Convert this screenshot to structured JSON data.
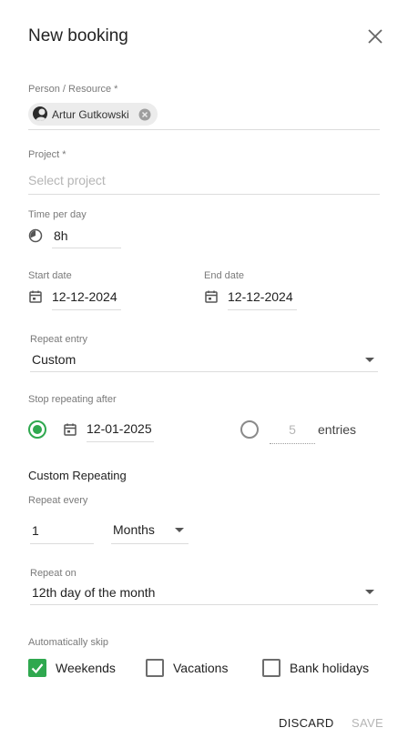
{
  "dialog": {
    "title": "New booking"
  },
  "person": {
    "label": "Person / Resource *",
    "chip_name": "Artur Gutkowski"
  },
  "project": {
    "label": "Project *",
    "placeholder": "Select project"
  },
  "time": {
    "label": "Time per day",
    "value": "8h"
  },
  "start_date": {
    "label": "Start date",
    "value": "12-12-2024"
  },
  "end_date": {
    "label": "End date",
    "value": "12-12-2024"
  },
  "repeat_entry": {
    "label": "Repeat entry",
    "value": "Custom"
  },
  "stop_repeating": {
    "label": "Stop repeating after",
    "date_value": "12-01-2025",
    "entries_value": "5",
    "entries_label": "entries"
  },
  "custom_repeating": {
    "title": "Custom Repeating",
    "repeat_every_label": "Repeat every",
    "repeat_every_value": "1",
    "unit_value": "Months",
    "repeat_on_label": "Repeat on",
    "repeat_on_value": "12th day of the month"
  },
  "skip": {
    "label": "Automatically skip",
    "weekends": "Weekends",
    "vacations": "Vacations",
    "bank_holidays": "Bank holidays"
  },
  "actions": {
    "discard": "DISCARD",
    "save": "SAVE"
  },
  "colors": {
    "accent": "#2fa84f",
    "disabled_text": "#b5b5b5"
  }
}
